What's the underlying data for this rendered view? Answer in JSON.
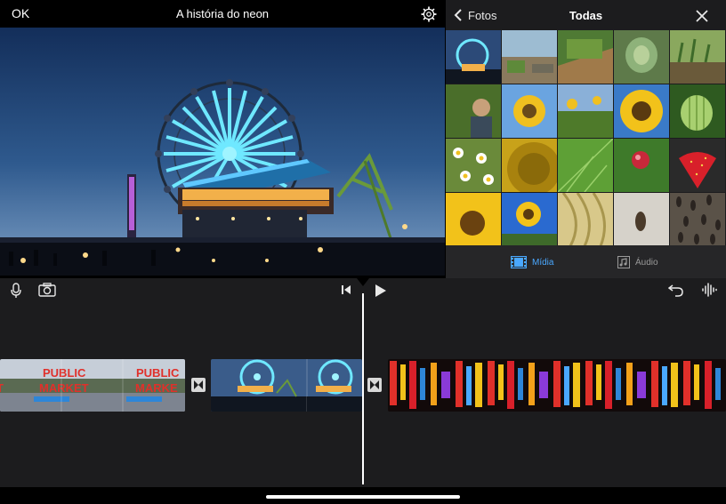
{
  "header": {
    "ok_label": "OK",
    "project_title": "A história do neon",
    "settings_icon": "gear-icon"
  },
  "media_browser": {
    "back_label": "Fotos",
    "title": "Todas",
    "close_icon": "close-icon",
    "thumbnails": [
      "ferris-wheel-pier",
      "garden-path",
      "raised-garden-bed",
      "artichoke-plant",
      "garden-sprouts",
      "person-in-garden",
      "sunflower-sky",
      "sunflower-field",
      "sunflower-closeup",
      "green-melon",
      "chamomile-flowers",
      "sunflower-center-macro",
      "green-leaf-macro",
      "red-radish",
      "strawberry",
      "sunflower-bloom",
      "sunflower-blue-sky",
      "corn-silk",
      "seed-on-table",
      "sunflower-seeds"
    ],
    "tabs": [
      {
        "label": "Mídia",
        "icon": "film-icon",
        "active": true
      },
      {
        "label": "Áudio",
        "icon": "music-note-icon",
        "active": false
      }
    ],
    "accent_color": "#4aa8ff"
  },
  "toolbar": {
    "left_icons": [
      "microphone-icon",
      "camera-icon"
    ],
    "center_icons": [
      "skip-to-start-icon",
      "play-icon"
    ],
    "right_icons": [
      "undo-icon",
      "audio-waveform-icon"
    ]
  },
  "timeline": {
    "clips": [
      {
        "name": "public-market-clip",
        "text": "PUBLIC MARKET"
      },
      {
        "name": "ferris-wheel-clip"
      },
      {
        "name": "neon-signs-clip"
      }
    ],
    "transitions": [
      "transition-1",
      "transition-2"
    ]
  }
}
